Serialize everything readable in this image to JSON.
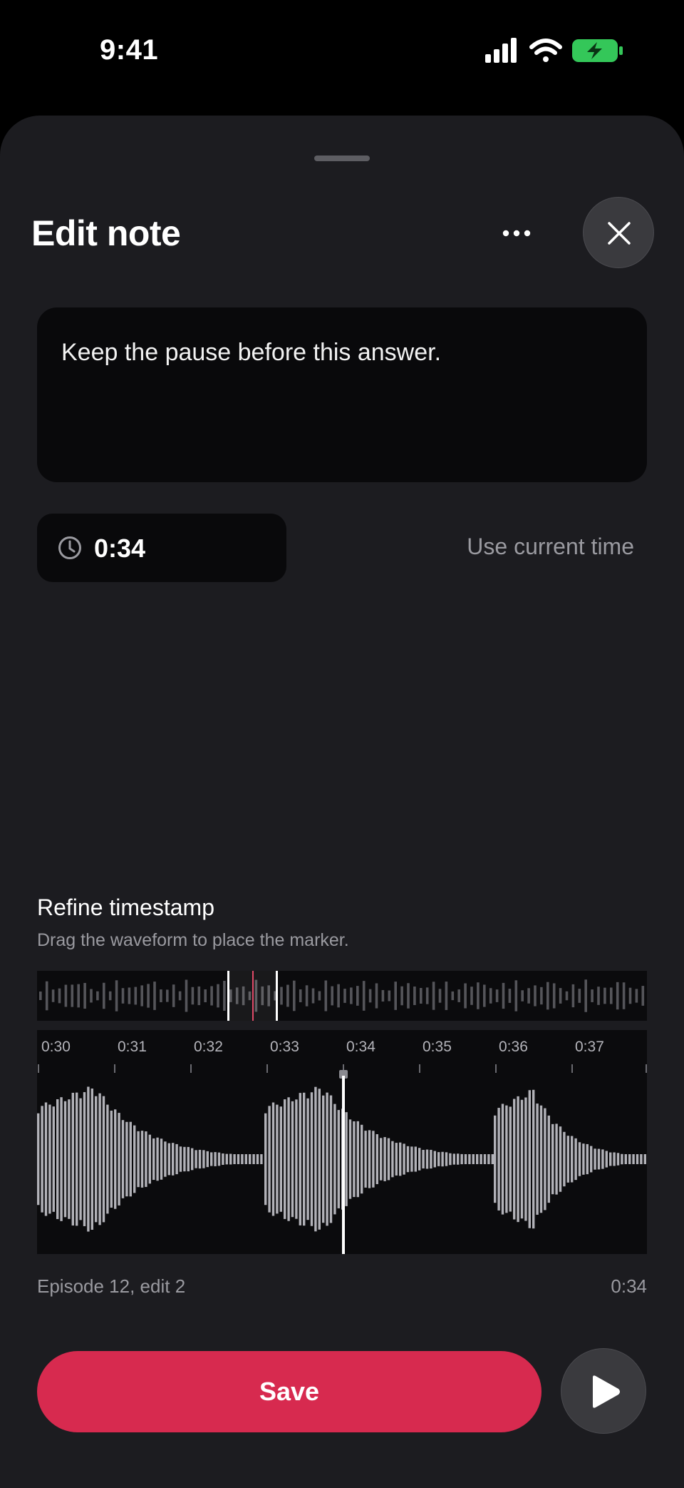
{
  "status_bar": {
    "time": "9:41",
    "icons": [
      "cellular-signal-icon",
      "wifi-icon",
      "battery-charging-icon"
    ]
  },
  "sheet": {
    "title": "Edit note",
    "more_icon": "ellipsis-icon",
    "close_icon": "close-icon"
  },
  "note": {
    "text": "Keep the pause before this answer."
  },
  "timestamp": {
    "icon": "clock-icon",
    "value": "0:34",
    "use_current_label": "Use current time"
  },
  "refine": {
    "title": "Refine timestamp",
    "subtitle": "Drag the waveform to place the marker.",
    "tick_labels": [
      "0:30",
      "0:31",
      "0:32",
      "0:33",
      "0:34",
      "0:35",
      "0:36",
      "0:37"
    ]
  },
  "footer": {
    "episode": "Episode 12, edit 2",
    "time": "0:34"
  },
  "actions": {
    "save_label": "Save",
    "play_icon": "play-icon"
  },
  "colors": {
    "accent": "#d72a4f",
    "background": "#1c1c20",
    "battery": "#34c759"
  }
}
